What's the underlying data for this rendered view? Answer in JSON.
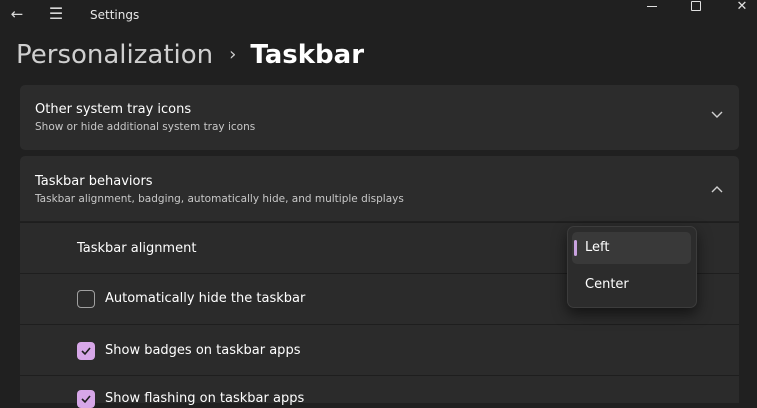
{
  "window": {
    "title": "Settings",
    "back_icon": "←",
    "menu_icon": "☰"
  },
  "breadcrumb": {
    "parent": "Personalization",
    "separator": "›",
    "current": "Taskbar"
  },
  "sections": {
    "system_tray": {
      "title": "Other system tray icons",
      "subtitle": "Show or hide additional system tray icons",
      "chevron": "⌄"
    },
    "behaviors": {
      "title": "Taskbar behaviors",
      "subtitle": "Taskbar alignment, badging, automatically hide, and multiple displays",
      "chevron": "⌃"
    }
  },
  "settings": {
    "alignment_label": "Taskbar alignment",
    "autohide_label": "Automatically hide the taskbar",
    "autohide_checked": false,
    "badges_label": "Show badges on taskbar apps",
    "badges_checked": true,
    "flashing_label": "Show flashing on taskbar apps",
    "flashing_checked": true
  },
  "alignment_dropdown": {
    "options": [
      "Left",
      "Center"
    ],
    "selected": "Left"
  },
  "colors": {
    "accent": "#d7a7e8",
    "background": "#202020",
    "card": "#2c2c2c"
  }
}
